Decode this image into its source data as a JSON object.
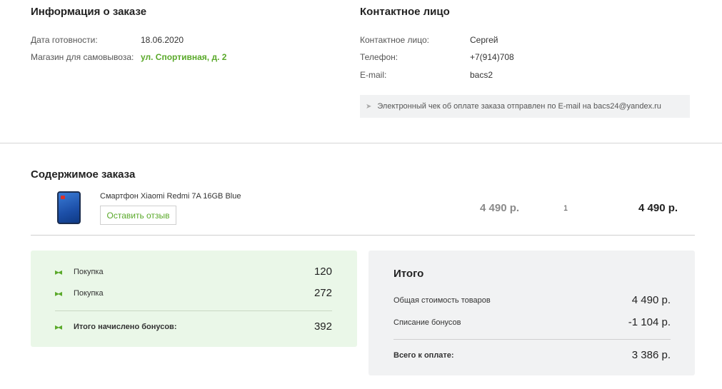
{
  "order_info": {
    "title": "Информация о заказе",
    "ready_date_label": "Дата готовности:",
    "ready_date_value": "18.06.2020",
    "pickup_store_label": "Магазин для самовывоза:",
    "pickup_store_value": "ул. Спортивная, д. 2"
  },
  "contact": {
    "title": "Контактное лицо",
    "name_label": "Контактное лицо:",
    "name_value": "Сергей",
    "phone_label": "Телефон:",
    "phone_value": "+7(914)708",
    "email_label": "E-mail:",
    "email_value": "bacs2",
    "receipt_note": "Электронный чек об оплате заказа отправлен по E-mail на bacs24@yandex.ru"
  },
  "order_contents": {
    "title": "Содержимое заказа",
    "items": [
      {
        "name": "Смартфон Xiaomi Redmi 7A 16GB Blue",
        "review_button": "Оставить отзыв",
        "unit_price": "4 490 р.",
        "quantity": "1",
        "total_price": "4 490 р."
      }
    ]
  },
  "bonuses": {
    "rows": [
      {
        "label": "Покупка",
        "value": "120"
      },
      {
        "label": "Покупка",
        "value": "272"
      }
    ],
    "total_label": "Итого начислено бонусов:",
    "total_value": "392"
  },
  "summary": {
    "title": "Итого",
    "goods_label": "Общая стоимость товаров",
    "goods_value": "4 490 р.",
    "bonus_writeoff_label": "Списание бонусов",
    "bonus_writeoff_value": "-1 104 р.",
    "total_label": "Всего к оплате:",
    "total_value": "3 386 р."
  },
  "colors": {
    "accent_green": "#5aa92a",
    "bonus_panel_bg": "#eaf7e8",
    "summary_panel_bg": "#f1f2f3"
  }
}
